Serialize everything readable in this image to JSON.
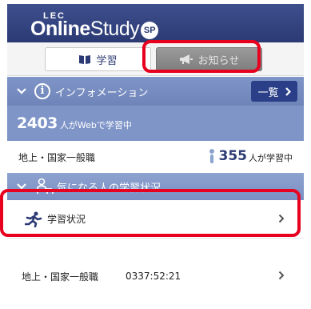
{
  "header": {
    "logo_lec": "LEC",
    "logo_online": "Online",
    "logo_study": "Study",
    "logo_sp": "SP"
  },
  "tabs": [
    {
      "label": "学習",
      "icon": "book-icon",
      "active": true
    },
    {
      "label": "お知らせ",
      "icon": "megaphone-icon",
      "active": false
    }
  ],
  "info_section": {
    "title": "インフォメーション",
    "more_label": "一覧"
  },
  "web_study": {
    "count": "2403",
    "text": "人がWebで学習中"
  },
  "exam_row": {
    "label": "地上・国家一般職",
    "count": "355",
    "text": "人が学習中"
  },
  "status_section": {
    "title": "気になる人の学習状況"
  },
  "status_link": {
    "label": "学習状況"
  },
  "course_row": {
    "label": "地上・国家一般職",
    "time": "0337:52:21"
  },
  "colors": {
    "header": "#2b3a73",
    "section": "#7f95c8",
    "highlight": "#e8001f",
    "button": "#2a3f88"
  }
}
